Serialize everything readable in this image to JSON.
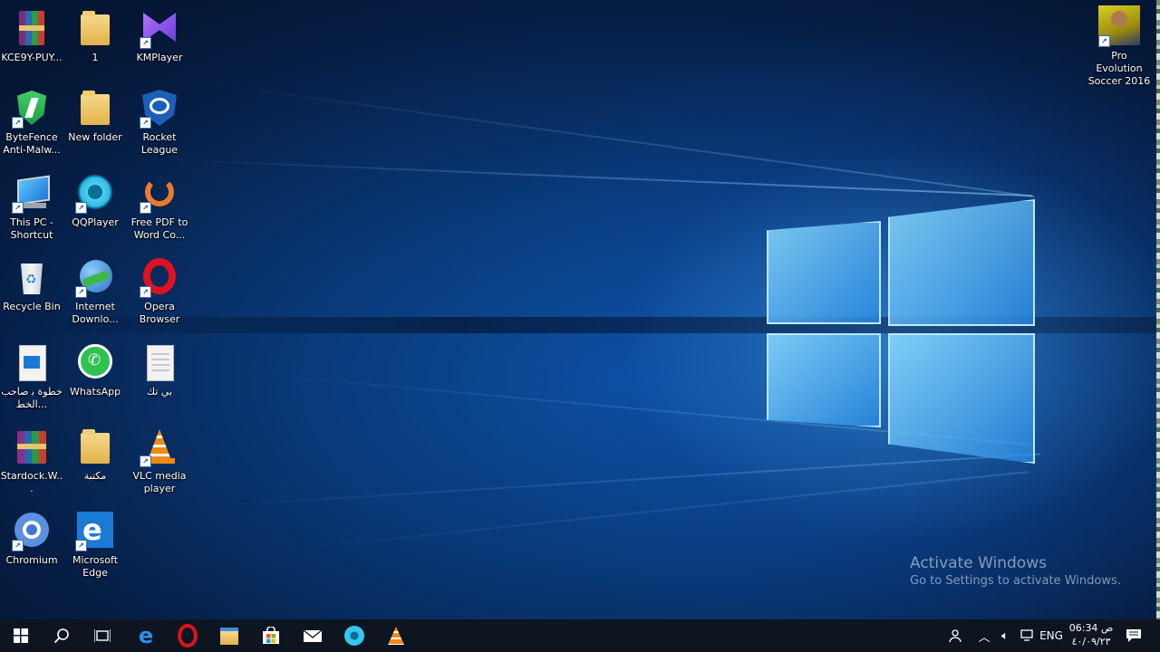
{
  "desktop": {
    "icons": [
      {
        "label": "KCE9Y-PUY..."
      },
      {
        "label": "1"
      },
      {
        "label": "KMPlayer"
      },
      {
        "label": "ByteFence Anti-Malw..."
      },
      {
        "label": "New folder"
      },
      {
        "label": "Rocket League"
      },
      {
        "label": "This PC - Shortcut"
      },
      {
        "label": "QQPlayer"
      },
      {
        "label": "Free PDF to Word Co..."
      },
      {
        "label": "Recycle Bin"
      },
      {
        "label": "Internet Downlo..."
      },
      {
        "label": "Opera Browser"
      },
      {
        "label": "خطوة ﺑ صاحب الخط..."
      },
      {
        "label": "WhatsApp"
      },
      {
        "label": "بي تك"
      },
      {
        "label": "Stardock.W..."
      },
      {
        "label": "مكتبة"
      },
      {
        "label": "VLC media player"
      },
      {
        "label": "Chromium"
      },
      {
        "label": "Microsoft Edge"
      },
      {
        "label": "Pro Evolution Soccer 2016"
      }
    ]
  },
  "watermark": {
    "title": "Activate Windows",
    "subtitle": "Go to Settings to activate Windows."
  },
  "taskbar": {
    "lang": "ENG",
    "time": "06:34 ص",
    "date": "٤٠/٠٩/٢٣"
  },
  "colors": {
    "taskbar": "#0d1521",
    "accent": "#1a73d8"
  }
}
